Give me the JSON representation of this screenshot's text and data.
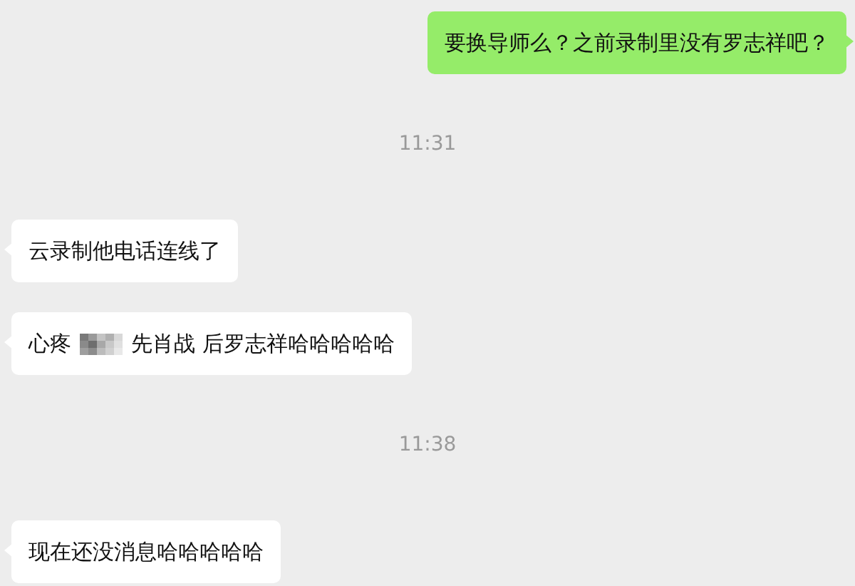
{
  "messages": [
    {
      "kind": "message",
      "outgoing": true,
      "parts": [
        {
          "text": "要换导师么？之前录制里没有罗志祥吧？"
        }
      ]
    },
    {
      "kind": "time",
      "text": "11:31"
    },
    {
      "kind": "message",
      "outgoing": false,
      "parts": [
        {
          "text": "云录制他电话连线了"
        }
      ]
    },
    {
      "kind": "message",
      "outgoing": false,
      "parts": [
        {
          "text": "心疼"
        },
        {
          "redacted": true
        },
        {
          "text": "先肖战 后罗志祥哈哈哈哈哈"
        }
      ]
    },
    {
      "kind": "time",
      "text": "11:38"
    },
    {
      "kind": "message",
      "outgoing": false,
      "parts": [
        {
          "text": "现在还没消息哈哈哈哈哈"
        }
      ]
    }
  ]
}
